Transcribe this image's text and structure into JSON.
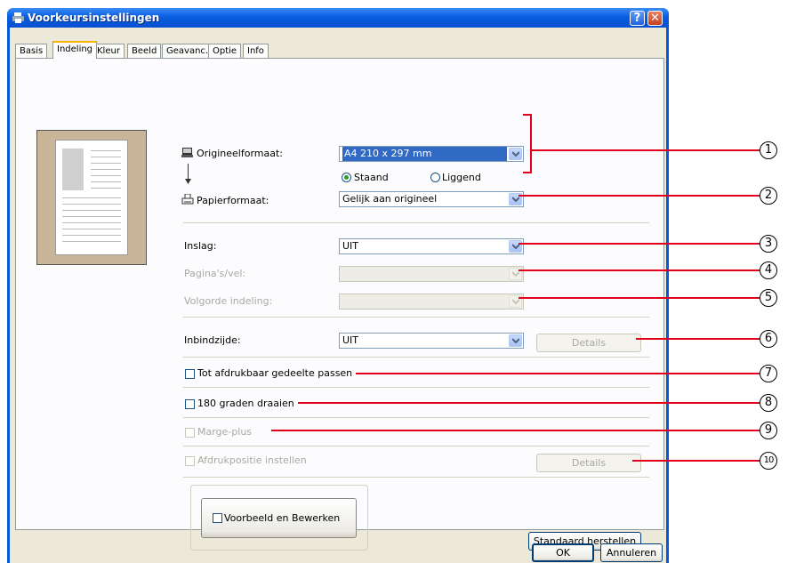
{
  "window": {
    "title": "Voorkeursinstellingen",
    "help_glyph": "?",
    "close_glyph": "✕"
  },
  "tabs": [
    {
      "label": "Basis",
      "active": false
    },
    {
      "label": "Indeling",
      "active": true
    },
    {
      "label": "Kleur",
      "active": false
    },
    {
      "label": "Beeld",
      "active": false
    },
    {
      "label": "Geavanc.",
      "active": false
    },
    {
      "label": "Optie",
      "active": false
    },
    {
      "label": "Info",
      "active": false
    }
  ],
  "layout": {
    "original_size": {
      "label": "Origineelformaat:",
      "value": "A4 210 x 297 mm",
      "icon": "monitor-icon"
    },
    "orientation": {
      "portrait_label": "Staand",
      "landscape_label": "Liggend",
      "selected": "Staand"
    },
    "arrow_icon": "down-arrow-icon",
    "paper_size": {
      "label": "Papierformaat:",
      "value": "Gelijk aan origineel",
      "icon": "printer-icon"
    },
    "imposition": {
      "label": "Inslag:",
      "value": "UIT"
    },
    "pages_per_sheet": {
      "label": "Pagina's/vel:",
      "value": "",
      "disabled": true
    },
    "layout_order": {
      "label": "Volgorde indeling:",
      "value": "",
      "disabled": true
    },
    "binding_side": {
      "label": "Inbindzijde:",
      "value": "UIT",
      "details_label": "Details"
    },
    "fit_printable": {
      "label": "Tot afdrukbaar gedeelte passen",
      "checked": false
    },
    "rotate_180": {
      "label": "180 graden draaien",
      "checked": false
    },
    "margin_plus": {
      "label": "Marge-plus",
      "checked": false,
      "disabled": true
    },
    "print_position": {
      "label": "Afdrukpositie instellen",
      "checked": false,
      "disabled": true,
      "details_label": "Details"
    },
    "preview_edit": {
      "label": "Voorbeeld en Bewerken",
      "checked": false
    },
    "restore_default_label": "Standaard herstellen"
  },
  "footer": {
    "ok_label": "OK",
    "cancel_label": "Annuleren"
  },
  "callouts": [
    "1",
    "2",
    "3",
    "4",
    "5",
    "6",
    "7",
    "8",
    "9",
    "10"
  ],
  "colors": {
    "titlebar": "#0a58d8",
    "callout_line": "#e2001a",
    "face": "#ece9d8",
    "selection": "#316ac5"
  }
}
